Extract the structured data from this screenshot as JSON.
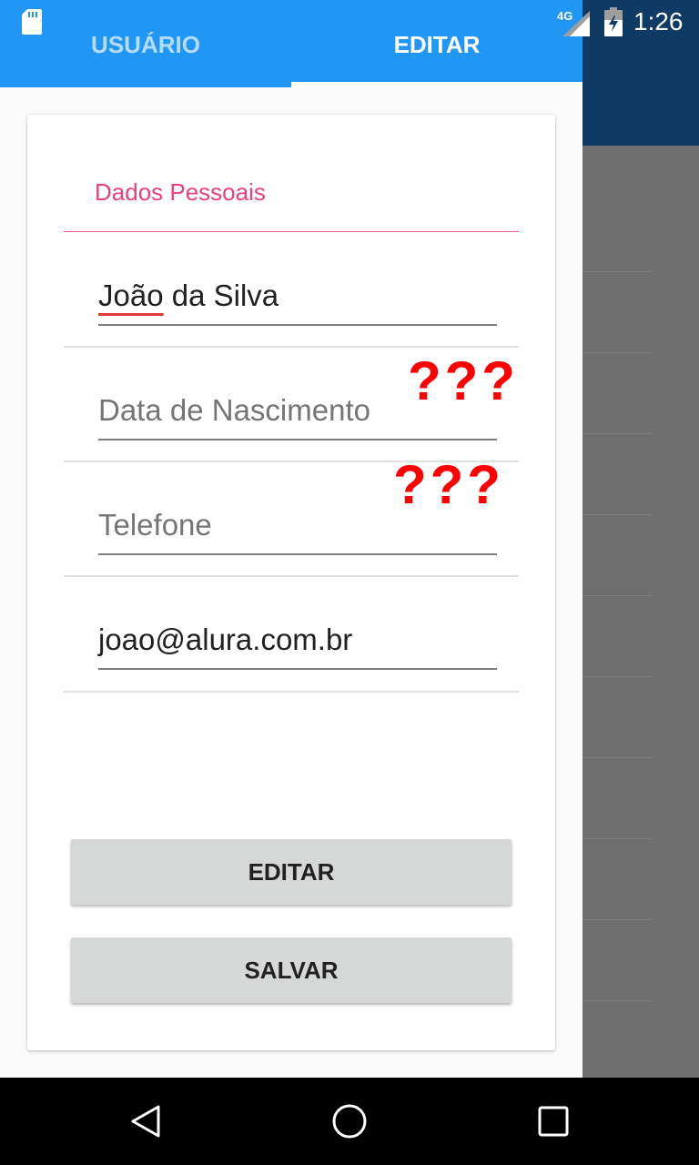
{
  "status_bar": {
    "network": "4G",
    "time": "1:26",
    "icons": [
      "sd-card-icon",
      "signal-icon",
      "battery-icon"
    ]
  },
  "tabs": [
    {
      "label": "USUÁRIO",
      "selected": false
    },
    {
      "label": "EDITAR",
      "selected": true
    }
  ],
  "form": {
    "section_title": "Dados Pessoais",
    "name": {
      "value": "João da Silva",
      "first_word": "João",
      "rest": " da Silva"
    },
    "birth_date": {
      "value": "",
      "placeholder": "Data de Nascimento"
    },
    "phone": {
      "value": "",
      "placeholder": "Telefone"
    },
    "email": {
      "value": "joao@alura.com.br"
    }
  },
  "annotations": [
    "???",
    "???"
  ],
  "buttons": {
    "edit": "EDITAR",
    "save": "SALVAR"
  },
  "colors": {
    "tab_bar": "#2196f3",
    "accent": "#ec407a",
    "annotation": "#ff0000",
    "background_appbar": "#0f3a63"
  },
  "navigation": [
    "back-icon",
    "home-icon",
    "recents-icon"
  ]
}
